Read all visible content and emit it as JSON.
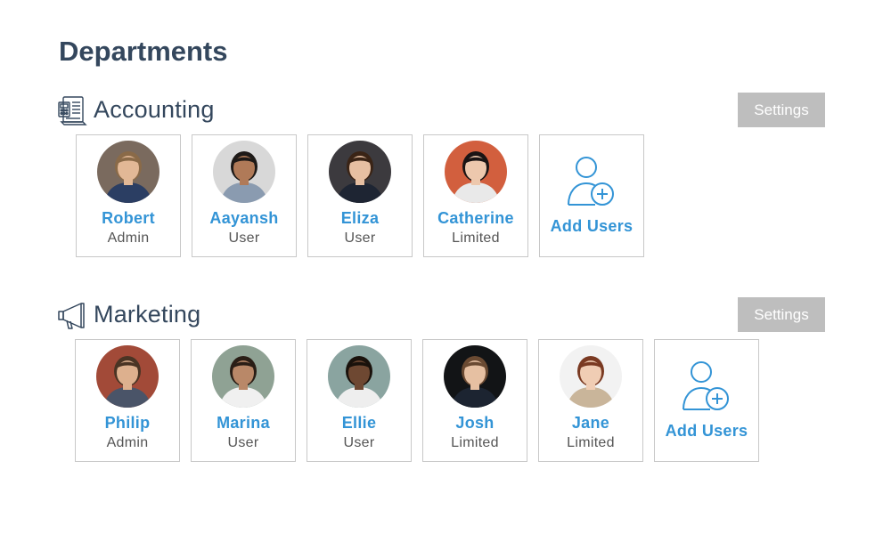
{
  "page": {
    "title": "Departments"
  },
  "colors": {
    "heading": "#34475d",
    "accent": "#3394d6",
    "settings_bg": "#bebebe",
    "card_border": "#c8c8c8"
  },
  "departments": [
    {
      "name": "Accounting",
      "icon": "calculator-document-icon",
      "settings_label": "Settings",
      "add_users_label": "Add Users",
      "users": [
        {
          "name": "Robert",
          "role": "Admin",
          "avatar_bg": "#7a6a5e",
          "skin": "#e2b896",
          "hair": "#8a6a48",
          "shirt": "#2b3e63"
        },
        {
          "name": "Aayansh",
          "role": "User",
          "avatar_bg": "#d8d8d8",
          "skin": "#b07a58",
          "hair": "#1e1a18",
          "shirt": "#8a9bb0"
        },
        {
          "name": "Eliza",
          "role": "User",
          "avatar_bg": "#3c3a3e",
          "skin": "#e6bfa2",
          "hair": "#3a2416",
          "shirt": "#1e2533"
        },
        {
          "name": "Catherine",
          "role": "Limited",
          "avatar_bg": "#d25f3e",
          "skin": "#edc8ad",
          "hair": "#1a1414",
          "shirt": "#e9e9e9"
        }
      ]
    },
    {
      "name": "Marketing",
      "icon": "megaphone-icon",
      "settings_label": "Settings",
      "add_users_label": "Add Users",
      "users": [
        {
          "name": "Philip",
          "role": "Admin",
          "avatar_bg": "#a24a38",
          "skin": "#ddb08e",
          "hair": "#4a3424",
          "shirt": "#4a5468"
        },
        {
          "name": "Marina",
          "role": "User",
          "avatar_bg": "#8fa294",
          "skin": "#b98868",
          "hair": "#2a1e16",
          "shirt": "#f0f0f0"
        },
        {
          "name": "Ellie",
          "role": "User",
          "avatar_bg": "#8aa4a0",
          "skin": "#6e4832",
          "hair": "#1a120c",
          "shirt": "#eeeeee"
        },
        {
          "name": "Josh",
          "role": "Limited",
          "avatar_bg": "#121416",
          "skin": "#e6c0a2",
          "hair": "#6a4a32",
          "shirt": "#1c2431"
        },
        {
          "name": "Jane",
          "role": "Limited",
          "avatar_bg": "#f2f2f2",
          "skin": "#f0cdb4",
          "hair": "#7a3a22",
          "shirt": "#c9b59a"
        }
      ]
    }
  ]
}
